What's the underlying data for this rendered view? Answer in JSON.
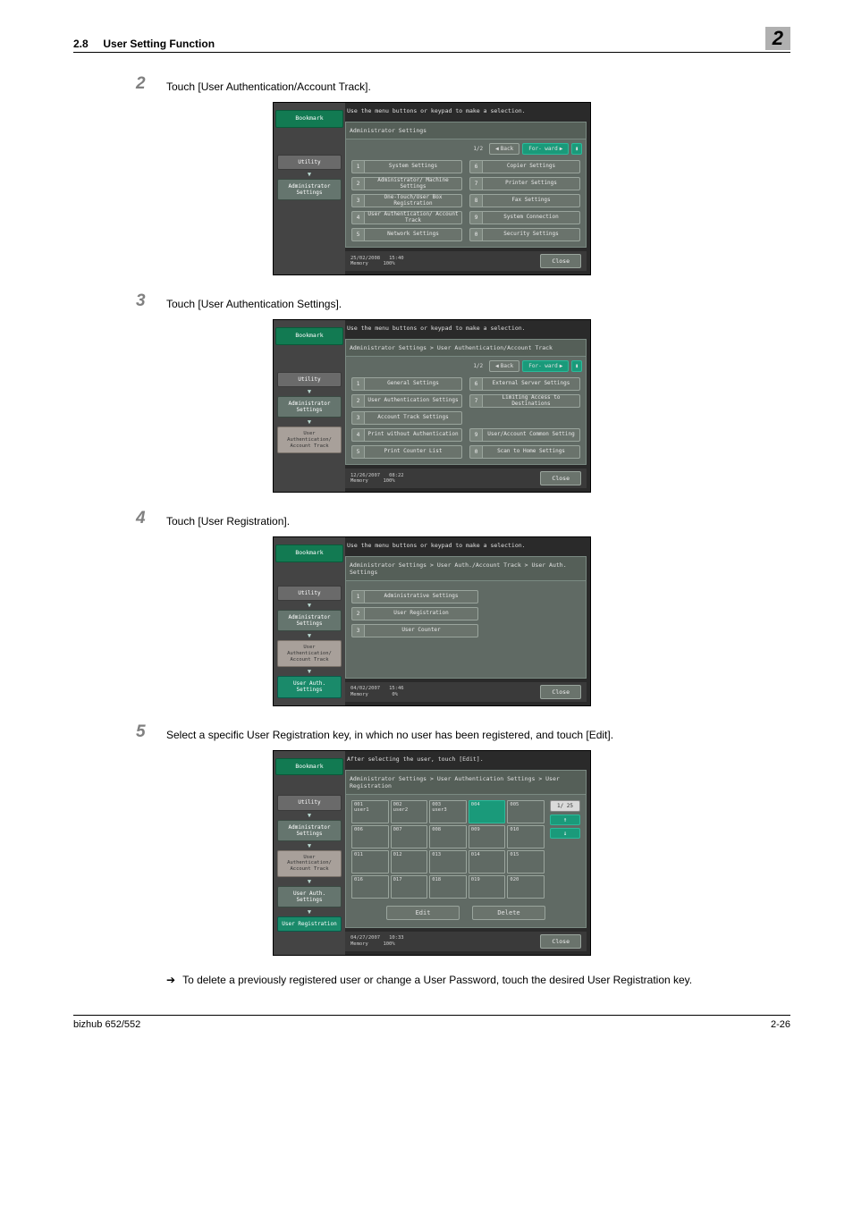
{
  "header": {
    "section_no": "2.8",
    "section_title": "User Setting Function",
    "chapter": "2"
  },
  "steps": {
    "s2": {
      "num": "2",
      "text": "Touch [User Authentication/Account Track]."
    },
    "s3": {
      "num": "3",
      "text": "Touch [User Authentication Settings]."
    },
    "s4": {
      "num": "4",
      "text": "Touch [User Registration]."
    },
    "s5": {
      "num": "5",
      "text": "Select a specific User Registration key, in which no user has been registered, and touch [Edit]."
    }
  },
  "note": {
    "arrow": "➔",
    "text": "To delete a previously registered user or change a User Password, touch the desired User Registration key."
  },
  "common": {
    "hint": "Use the menu buttons or keypad to make a selection.",
    "hint4": "After selecting the user, touch [Edit].",
    "bookmark": "Bookmark",
    "utility": "Utility",
    "admin": "Administrator Settings",
    "authtrack": "User Authentication/ Account Track",
    "uauth": "User Auth. Settings",
    "ureg": "User Registration",
    "back": "Back",
    "fwd": "For- ward",
    "close": "Close",
    "memory": "Memory",
    "pct100": "100%",
    "pct0": "0%",
    "edit": "Edit",
    "delete": "Delete",
    "page12": "1/2",
    "page125": "1/ 25"
  },
  "screen1": {
    "title": "Administrator Settings",
    "date": "25/02/2008",
    "time": "15:40",
    "items": [
      {
        "n": "1",
        "l": "System Settings"
      },
      {
        "n": "6",
        "l": "Copier Settings"
      },
      {
        "n": "2",
        "l": "Administrator/ Machine Settings"
      },
      {
        "n": "7",
        "l": "Printer Settings"
      },
      {
        "n": "3",
        "l": "One-Touch/User Box Registration"
      },
      {
        "n": "8",
        "l": "Fax Settings"
      },
      {
        "n": "4",
        "l": "User Authentication/ Account Track"
      },
      {
        "n": "9",
        "l": "System Connection"
      },
      {
        "n": "5",
        "l": "Network Settings"
      },
      {
        "n": "0",
        "l": "Security Settings"
      }
    ]
  },
  "screen2": {
    "title": "Administrator Settings > User Authentication/Account Track",
    "date": "12/26/2007",
    "time": "08:22",
    "items": [
      {
        "n": "1",
        "l": "General Settings"
      },
      {
        "n": "6",
        "l": "External Server Settings"
      },
      {
        "n": "2",
        "l": "User Authentication Settings"
      },
      {
        "n": "7",
        "l": "Limiting Access to Destinations"
      },
      {
        "n": "3",
        "l": "Account Track Settings"
      },
      {
        "n": "",
        "l": ""
      },
      {
        "n": "4",
        "l": "Print without Authentication"
      },
      {
        "n": "9",
        "l": "User/Account Common Setting"
      },
      {
        "n": "5",
        "l": "Print Counter List"
      },
      {
        "n": "0",
        "l": "Scan to Home Settings"
      }
    ]
  },
  "screen3": {
    "title": "Administrator Settings > User Auth./Account Track > User Auth. Settings",
    "date": "04/02/2007",
    "time": "15:46",
    "items": [
      {
        "n": "1",
        "l": "Administrative Settings"
      },
      {
        "n": "2",
        "l": "User Registration"
      },
      {
        "n": "3",
        "l": "User Counter"
      }
    ]
  },
  "screen4": {
    "title": "Administrator Settings > User Authentication Settings > User Registration",
    "date": "04/27/2007",
    "time": "10:33",
    "cells": [
      {
        "n": "001",
        "u": "user1"
      },
      {
        "n": "002",
        "u": "user2"
      },
      {
        "n": "003",
        "u": "user3"
      },
      {
        "n": "004",
        "u": "",
        "sel": true
      },
      {
        "n": "005",
        "u": ""
      },
      {
        "n": "006",
        "u": ""
      },
      {
        "n": "007",
        "u": ""
      },
      {
        "n": "008",
        "u": ""
      },
      {
        "n": "009",
        "u": ""
      },
      {
        "n": "010",
        "u": ""
      },
      {
        "n": "011",
        "u": ""
      },
      {
        "n": "012",
        "u": ""
      },
      {
        "n": "013",
        "u": ""
      },
      {
        "n": "014",
        "u": ""
      },
      {
        "n": "015",
        "u": ""
      },
      {
        "n": "016",
        "u": ""
      },
      {
        "n": "017",
        "u": ""
      },
      {
        "n": "018",
        "u": ""
      },
      {
        "n": "019",
        "u": ""
      },
      {
        "n": "020",
        "u": ""
      }
    ]
  },
  "footer": {
    "left": "bizhub 652/552",
    "right": "2-26"
  }
}
